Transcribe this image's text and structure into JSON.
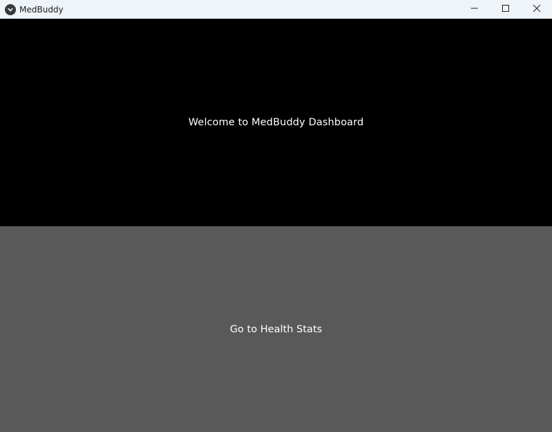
{
  "window": {
    "title": "MedBuddy",
    "icon": "app-logo-icon",
    "controls": {
      "minimize_icon": "minimize-icon",
      "maximize_icon": "maximize-icon",
      "close_icon": "close-icon"
    }
  },
  "dashboard": {
    "welcome_text": "Welcome to MedBuddy Dashboard",
    "health_stats_button_label": "Go to Health Stats"
  },
  "colors": {
    "titlebar_bg": "#eff4f9",
    "header_bg": "#000000",
    "button_bg": "#595959",
    "text": "#ffffff"
  }
}
